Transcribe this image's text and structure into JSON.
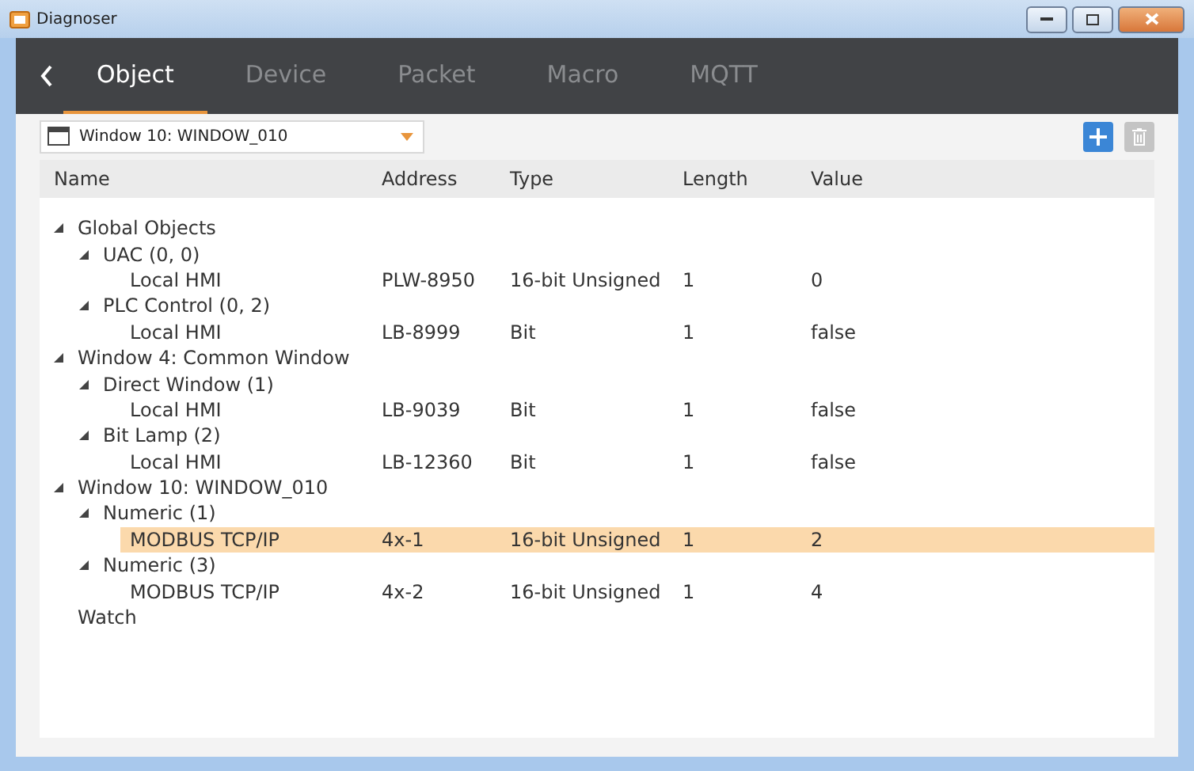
{
  "window": {
    "title": "Diagnoser"
  },
  "tabs": [
    {
      "label": "Object",
      "selected": true
    },
    {
      "label": "Device",
      "selected": false
    },
    {
      "label": "Packet",
      "selected": false
    },
    {
      "label": "Macro",
      "selected": false
    },
    {
      "label": "MQTT",
      "selected": false
    }
  ],
  "window_select": {
    "value": "Window 10: WINDOW_010"
  },
  "table": {
    "columns": [
      "Name",
      "Address",
      "Type",
      "Length",
      "Value"
    ],
    "rows": [
      {
        "name": "Global Objects",
        "expanded": true,
        "selected": false,
        "children": [
          {
            "name": "UAC (0, 0)",
            "expanded": true,
            "selected": false,
            "children": [
              {
                "name": "Local HMI",
                "address": "PLW-8950",
                "type": "16-bit Unsigned",
                "length": "1",
                "value": "0",
                "selected": false
              }
            ]
          },
          {
            "name": "PLC Control (0, 2)",
            "expanded": true,
            "selected": false,
            "children": [
              {
                "name": "Local HMI",
                "address": "LB-8999",
                "type": "Bit",
                "length": "1",
                "value": "false",
                "selected": false
              }
            ]
          }
        ]
      },
      {
        "name": "Window 4: Common Window",
        "expanded": true,
        "selected": false,
        "children": [
          {
            "name": "Direct Window (1)",
            "expanded": true,
            "selected": false,
            "children": [
              {
                "name": "Local HMI",
                "address": "LB-9039",
                "type": "Bit",
                "length": "1",
                "value": "false",
                "selected": false
              }
            ]
          },
          {
            "name": "Bit Lamp (2)",
            "expanded": true,
            "selected": false,
            "children": [
              {
                "name": "Local HMI",
                "address": "LB-12360",
                "type": "Bit",
                "length": "1",
                "value": "false",
                "selected": false
              }
            ]
          }
        ]
      },
      {
        "name": "Window 10: WINDOW_010",
        "expanded": true,
        "selected": false,
        "children": [
          {
            "name": "Numeric (1)",
            "expanded": true,
            "selected": false,
            "children": [
              {
                "name": "MODBUS TCP/IP",
                "address": "4x-1",
                "type": "16-bit Unsigned",
                "length": "1",
                "value": "2",
                "selected": true
              }
            ]
          },
          {
            "name": "Numeric (3)",
            "expanded": true,
            "selected": false,
            "children": [
              {
                "name": "MODBUS TCP/IP",
                "address": "4x-2",
                "type": "16-bit Unsigned",
                "length": "1",
                "value": "4",
                "selected": false
              }
            ]
          }
        ]
      },
      {
        "name": "Watch",
        "selected": false
      }
    ]
  }
}
